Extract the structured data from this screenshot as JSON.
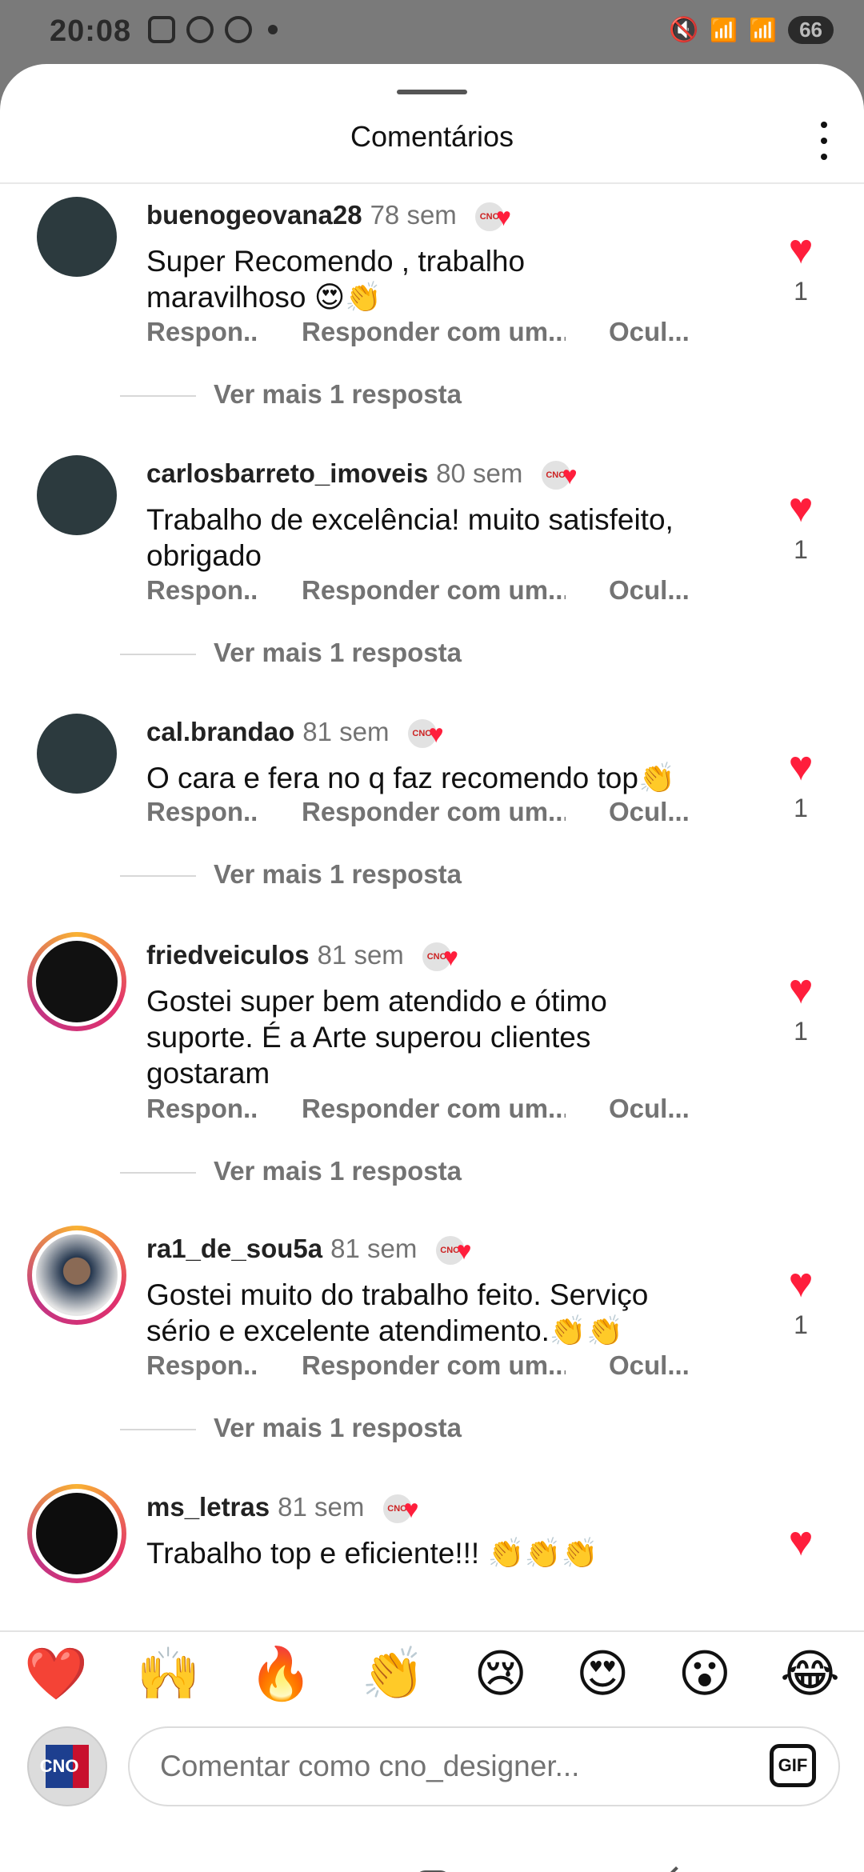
{
  "status_bar": {
    "time": "20:08",
    "battery": "66"
  },
  "sheet": {
    "title": "Comentários"
  },
  "comments": [
    {
      "username": "buenogeovana28",
      "time": "78 sem",
      "text_lines": [
        "Super Recomendo , trabalho",
        "maravilhoso 😍👏"
      ],
      "actions": [
        "Respon...",
        "Responder com um...",
        "Ocul..."
      ],
      "replies": "Ver mais 1 resposta",
      "likes": "1"
    },
    {
      "username": "carlosbarreto_imoveis",
      "time": "80 sem",
      "text_lines": [
        "Trabalho de excelência! muito satisfeito,",
        "obrigado"
      ],
      "actions": [
        "Respon...",
        "Responder com um...",
        "Ocul..."
      ],
      "replies": "Ver mais 1 resposta",
      "likes": "1"
    },
    {
      "username": "cal.brandao",
      "time": "81 sem",
      "text_lines": [
        "O cara e fera no q faz recomendo top👏"
      ],
      "actions": [
        "Respon...",
        "Responder com um...",
        "Ocul..."
      ],
      "replies": "Ver mais 1 resposta",
      "likes": "1"
    },
    {
      "username": "friedveiculos",
      "time": "81 sem",
      "text_lines": [
        "Gostei super bem atendido e ótimo",
        "suporte. É a Arte superou clientes",
        "gostaram"
      ],
      "actions": [
        "Respon...",
        "Responder com um...",
        "Ocul..."
      ],
      "replies": "Ver mais 1 resposta",
      "likes": "1"
    },
    {
      "username": "ra1_de_sou5a",
      "time": "81 sem",
      "text_lines": [
        "Gostei muito do trabalho feito. Serviço",
        "sério e excelente atendimento.👏👏"
      ],
      "actions": [
        "Respon...",
        "Responder com um...",
        "Ocul..."
      ],
      "replies": "Ver mais 1 resposta",
      "likes": "1"
    },
    {
      "username": "ms_letras",
      "time": "81 sem",
      "text_lines": [
        "Trabalho top e eficiente!!! 👏👏👏"
      ]
    }
  ],
  "reactions": [
    "❤️",
    "🙌",
    "🔥",
    "👏",
    "😢",
    "😍",
    "😮",
    "😂"
  ],
  "composer": {
    "placeholder": "Comentar como cno_designer...",
    "gif_label": "GIF"
  },
  "icons": {
    "like": "heart-icon",
    "more": "more-options-icon",
    "gif": "gif-icon",
    "nav": [
      "recent-apps-icon",
      "home-icon",
      "back-icon"
    ]
  },
  "colors": {
    "like_red": "#ff1e3c",
    "muted_text": "#737373"
  }
}
